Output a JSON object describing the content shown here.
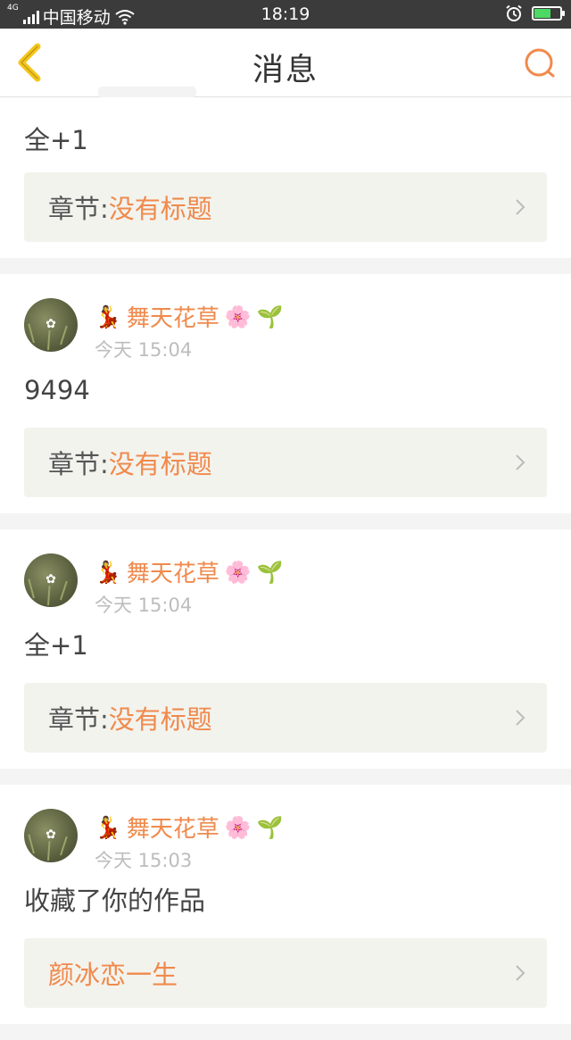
{
  "status_bar": {
    "carrier": "中国移动",
    "network": "4G",
    "time": "18:19"
  },
  "header": {
    "title": "消息"
  },
  "colors": {
    "accent": "#f08a4c",
    "back_arrow": "#f5c518"
  },
  "feed": [
    {
      "partial": true,
      "comment": "全+1",
      "chapter_label": "章节:",
      "chapter_title": "没有标题"
    },
    {
      "username": "舞天花草",
      "prefix_emoji": "💃",
      "suffix_emoji": "🌸",
      "badge_emoji": "🌱",
      "time": "今天 15:04",
      "comment": "9494",
      "chapter_label": "章节:",
      "chapter_title": "没有标题"
    },
    {
      "username": "舞天花草",
      "prefix_emoji": "💃",
      "suffix_emoji": "🌸",
      "badge_emoji": "🌱",
      "time": "今天 15:04",
      "comment": "全+1",
      "chapter_label": "章节:",
      "chapter_title": "没有标题"
    },
    {
      "username": "舞天花草",
      "prefix_emoji": "💃",
      "suffix_emoji": "🌸",
      "badge_emoji": "🌱",
      "time": "今天 15:03",
      "comment": "收藏了你的作品",
      "work_title": "颜冰恋一生"
    }
  ]
}
